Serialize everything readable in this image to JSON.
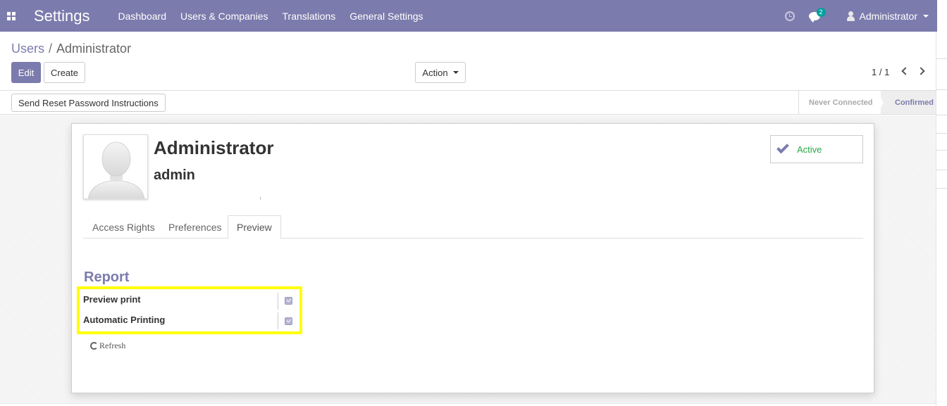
{
  "navbar": {
    "brand": "Settings",
    "menu": [
      "Dashboard",
      "Users & Companies",
      "Translations",
      "General Settings"
    ],
    "chat_count": "2",
    "user": "Administrator"
  },
  "breadcrumb": {
    "parent": "Users",
    "separator": "/",
    "current": "Administrator"
  },
  "toolbar": {
    "edit": "Edit",
    "create": "Create",
    "action": "Action"
  },
  "pager": {
    "value": "1 / 1"
  },
  "statusbar": {
    "reset_button": "Send Reset Password Instructions",
    "stages": [
      "Never Connected",
      "Confirmed"
    ],
    "current_stage": "Confirmed"
  },
  "form": {
    "name": "Administrator",
    "login": "admin",
    "active_label": "Active",
    "tabs": [
      "Access Rights",
      "Preferences",
      "Preview"
    ],
    "active_tab": "Preview",
    "section_title": "Report",
    "fields": [
      {
        "label": "Preview print",
        "checked": true
      },
      {
        "label": "Automatic Printing",
        "checked": true
      }
    ],
    "refresh": "Refresh"
  },
  "colors": {
    "brand": "#7c7bad",
    "highlight": "#ffff00",
    "active_green": "#28a745"
  }
}
